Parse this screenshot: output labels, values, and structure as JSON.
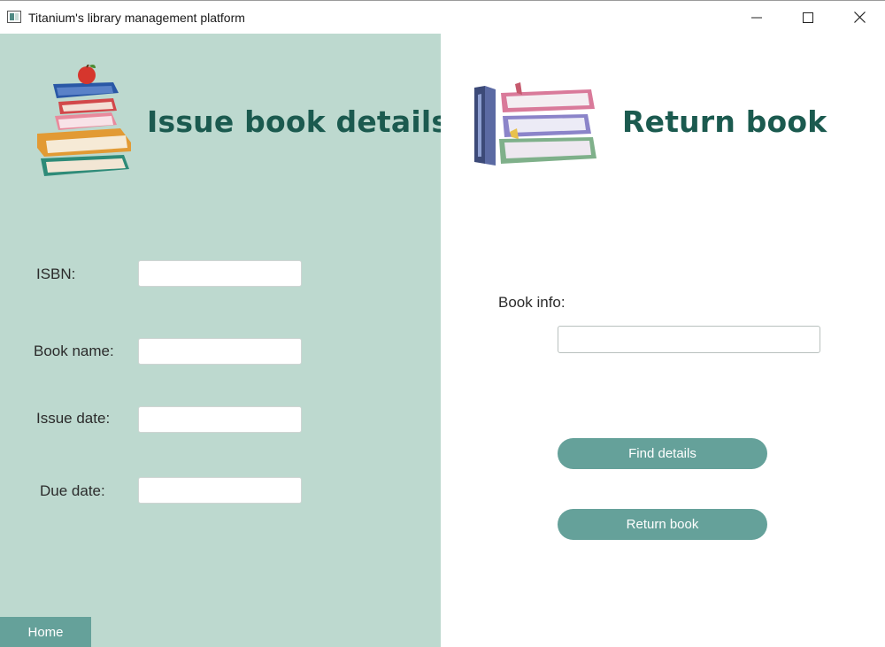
{
  "window": {
    "title": "Titanium's library management platform",
    "icon": "app-window-icon",
    "controls": [
      "minimize-icon",
      "maximize-icon",
      "close-icon"
    ]
  },
  "issue_panel": {
    "heading": "Issue book details",
    "illustration": "book-stack-with-apple",
    "fields": {
      "isbn_label": "ISBN:",
      "isbn_value": "",
      "book_name_label": "Book name:",
      "book_name_value": "",
      "issue_date_label": "Issue date:",
      "issue_date_value": "",
      "due_date_label": "Due date:",
      "due_date_value": ""
    },
    "home_label": "Home"
  },
  "return_panel": {
    "heading": "Return book",
    "illustration": "book-stack",
    "book_info_label": "Book info:",
    "book_info_value": "",
    "find_details_label": "Find details",
    "return_book_label": "Return book"
  },
  "colors": {
    "left_panel_bg": "#bdd9cf",
    "heading": "#1b5a4f",
    "button": "#65a19a"
  }
}
